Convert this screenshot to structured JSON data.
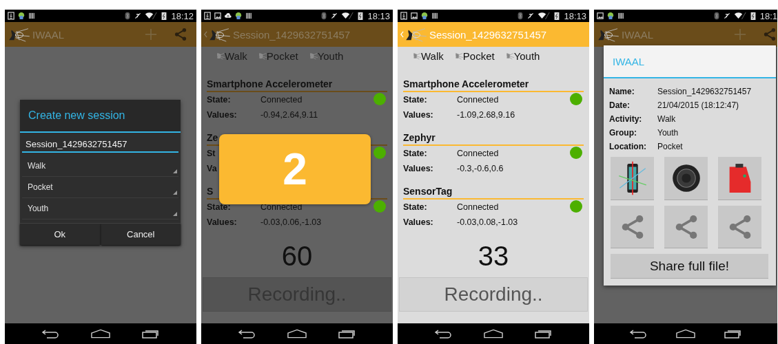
{
  "phones": [
    {
      "kind": "new-session",
      "dimmed": true,
      "status": {
        "notifications": [
          {
            "kind": "download"
          },
          {
            "kind": "android"
          },
          {
            "kind": "barcode"
          }
        ],
        "time": "18:12"
      },
      "action_bar": {
        "title": "IWAAL",
        "back": false,
        "actions": true
      },
      "dialog": {
        "title": "Create new session",
        "input": "Session_1429632751457",
        "spinners": [
          "Walk",
          "Pocket",
          "Youth"
        ],
        "buttons": [
          "Ok",
          "Cancel"
        ]
      }
    },
    {
      "kind": "recording",
      "dimmed": true,
      "status": {
        "notifications": [
          {
            "kind": "download"
          },
          {
            "kind": "image"
          },
          {
            "kind": "cloud"
          },
          {
            "kind": "android"
          },
          {
            "kind": "barcode"
          }
        ],
        "time": "18:13"
      },
      "action_bar": {
        "title": "Session_1429632751457",
        "back": true,
        "actions": false
      },
      "tags": [
        "Walk",
        "Pocket",
        "Youth"
      ],
      "sensors": [
        {
          "name": "Smartphone Accelerometer",
          "state_label": "State:",
          "state": "Connected",
          "values_label": "Values:",
          "values": "-0.94,2.64,9.11",
          "connected": true
        },
        {
          "name": "Ze",
          "state_label": "St",
          "values_label": "Va",
          "connected": true
        },
        {
          "name": "S",
          "state_label": "State:",
          "state": "Connected",
          "values_label": "Values:",
          "values": "-0.03,0.06,-1.03",
          "connected": true
        }
      ],
      "counter": "60",
      "record_button": "Recording..",
      "toast": "2"
    },
    {
      "kind": "recording",
      "dimmed": false,
      "status": {
        "notifications": [
          {
            "kind": "download"
          },
          {
            "kind": "image"
          },
          {
            "kind": "android"
          },
          {
            "kind": "barcode"
          }
        ],
        "time": "18:13"
      },
      "action_bar": {
        "title": "Session_1429632751457",
        "back": true,
        "actions": false
      },
      "tags": [
        "Walk",
        "Pocket",
        "Youth"
      ],
      "sensors": [
        {
          "name": "Smartphone Accelerometer",
          "state_label": "State:",
          "state": "Connected",
          "values_label": "Values:",
          "values": "-1.09,2.68,9.16",
          "connected": true
        },
        {
          "name": "Zephyr",
          "state_label": "State:",
          "state": "Connected",
          "values_label": "Values:",
          "values": "-0.3,-0.6,0.6",
          "connected": true
        },
        {
          "name": "SensorTag",
          "state_label": "State:",
          "state": "Connected",
          "values_label": "Values:",
          "values": "-0.03,0.08,-1.03",
          "connected": true
        }
      ],
      "counter": "33",
      "record_button": "Recording.."
    },
    {
      "kind": "session-info",
      "dimmed": true,
      "status": {
        "notifications": [
          {
            "kind": "image"
          },
          {
            "kind": "android"
          },
          {
            "kind": "barcode"
          }
        ],
        "time": "18:1"
      },
      "action_bar": {
        "title": "IWAAL",
        "back": false,
        "actions": true
      },
      "dialog": {
        "title": "IWAAL",
        "fields": [
          {
            "label": "Name:",
            "value": "Session_1429632751457"
          },
          {
            "label": "Date:",
            "value": "21/04/2015 (18:12:47)"
          },
          {
            "label": "Activity:",
            "value": "Walk"
          },
          {
            "label": "Group:",
            "value": "Youth"
          },
          {
            "label": "Location:",
            "value": "Pocket"
          }
        ],
        "tiles": [
          {
            "kind": "phone"
          },
          {
            "kind": "round-device"
          },
          {
            "kind": "box"
          }
        ],
        "share_button": "Share full file!"
      }
    }
  ]
}
